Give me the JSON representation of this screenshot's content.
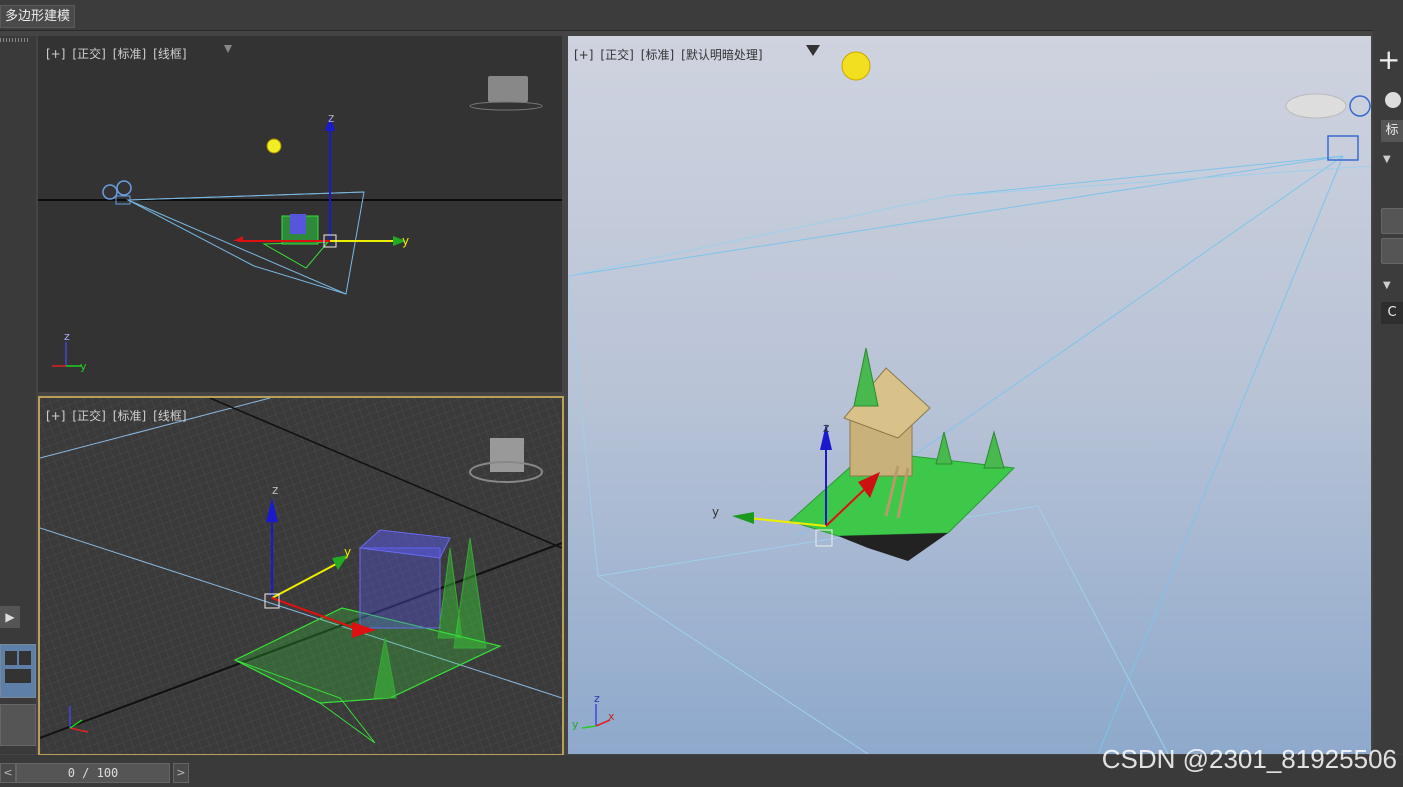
{
  "app": {
    "ribbon_tab": "多边形建模"
  },
  "viewports": {
    "top_left": {
      "labels": [
        "[+]",
        "[正交]",
        "[标准]",
        "[线框]"
      ]
    },
    "bottom_left": {
      "labels": [
        "[+]",
        "[正交]",
        "[标准]",
        "[线框]"
      ]
    },
    "perspective": {
      "labels": [
        "[+]",
        "[正交]",
        "[标准]",
        "[默认明暗处理]"
      ]
    },
    "axis": {
      "x": "x",
      "y": "y",
      "z": "z"
    }
  },
  "timeline": {
    "frame_display": "0 / 100",
    "prev": "<",
    "next": ">"
  },
  "right_panel": {
    "plus": "+",
    "tab_label": "标",
    "c_label": "C"
  },
  "watermark": "CSDN @2301_81925506",
  "colors": {
    "viewport_dark": "#333333",
    "active_border": "#b8a05a",
    "wire_green": "#38e038",
    "wire_blue": "#6a6af0",
    "sky_top": "#cfd3df",
    "sky_bottom": "#8ea9cc"
  }
}
